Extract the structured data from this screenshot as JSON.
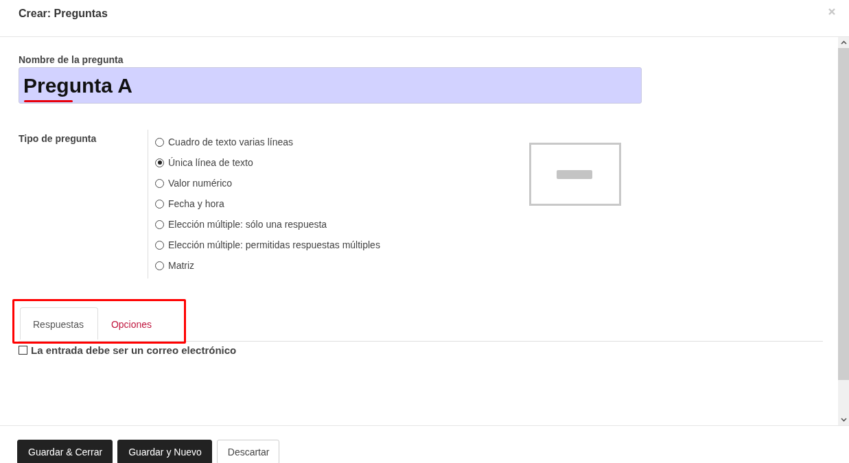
{
  "dialog": {
    "title": "Crear: Preguntas"
  },
  "name_field": {
    "label": "Nombre de la pregunta",
    "value": "Pregunta A",
    "spelling_error": true
  },
  "question_type": {
    "label": "Tipo de pregunta",
    "options": [
      {
        "label": "Cuadro de texto varias líneas",
        "selected": false
      },
      {
        "label": "Única línea de texto",
        "selected": true
      },
      {
        "label": "Valor numérico",
        "selected": false
      },
      {
        "label": "Fecha y hora",
        "selected": false
      },
      {
        "label": "Elección múltiple: sólo una respuesta",
        "selected": false
      },
      {
        "label": "Elección múltiple: permitidas respuestas múltiples",
        "selected": false
      },
      {
        "label": "Matriz",
        "selected": false
      }
    ]
  },
  "tabs_highlighted": true,
  "tabs": [
    {
      "label": "Respuestas",
      "selected": true
    },
    {
      "label": "Opciones",
      "selected": false
    }
  ],
  "email_check": {
    "label": "La entrada debe ser un correo electrónico",
    "checked": false
  },
  "buttons": [
    {
      "label": "Guardar & Cerrar",
      "kind": "primary"
    },
    {
      "label": "Guardar y Nuevo",
      "kind": "primary"
    },
    {
      "label": "Descartar",
      "kind": "secondary"
    }
  ]
}
